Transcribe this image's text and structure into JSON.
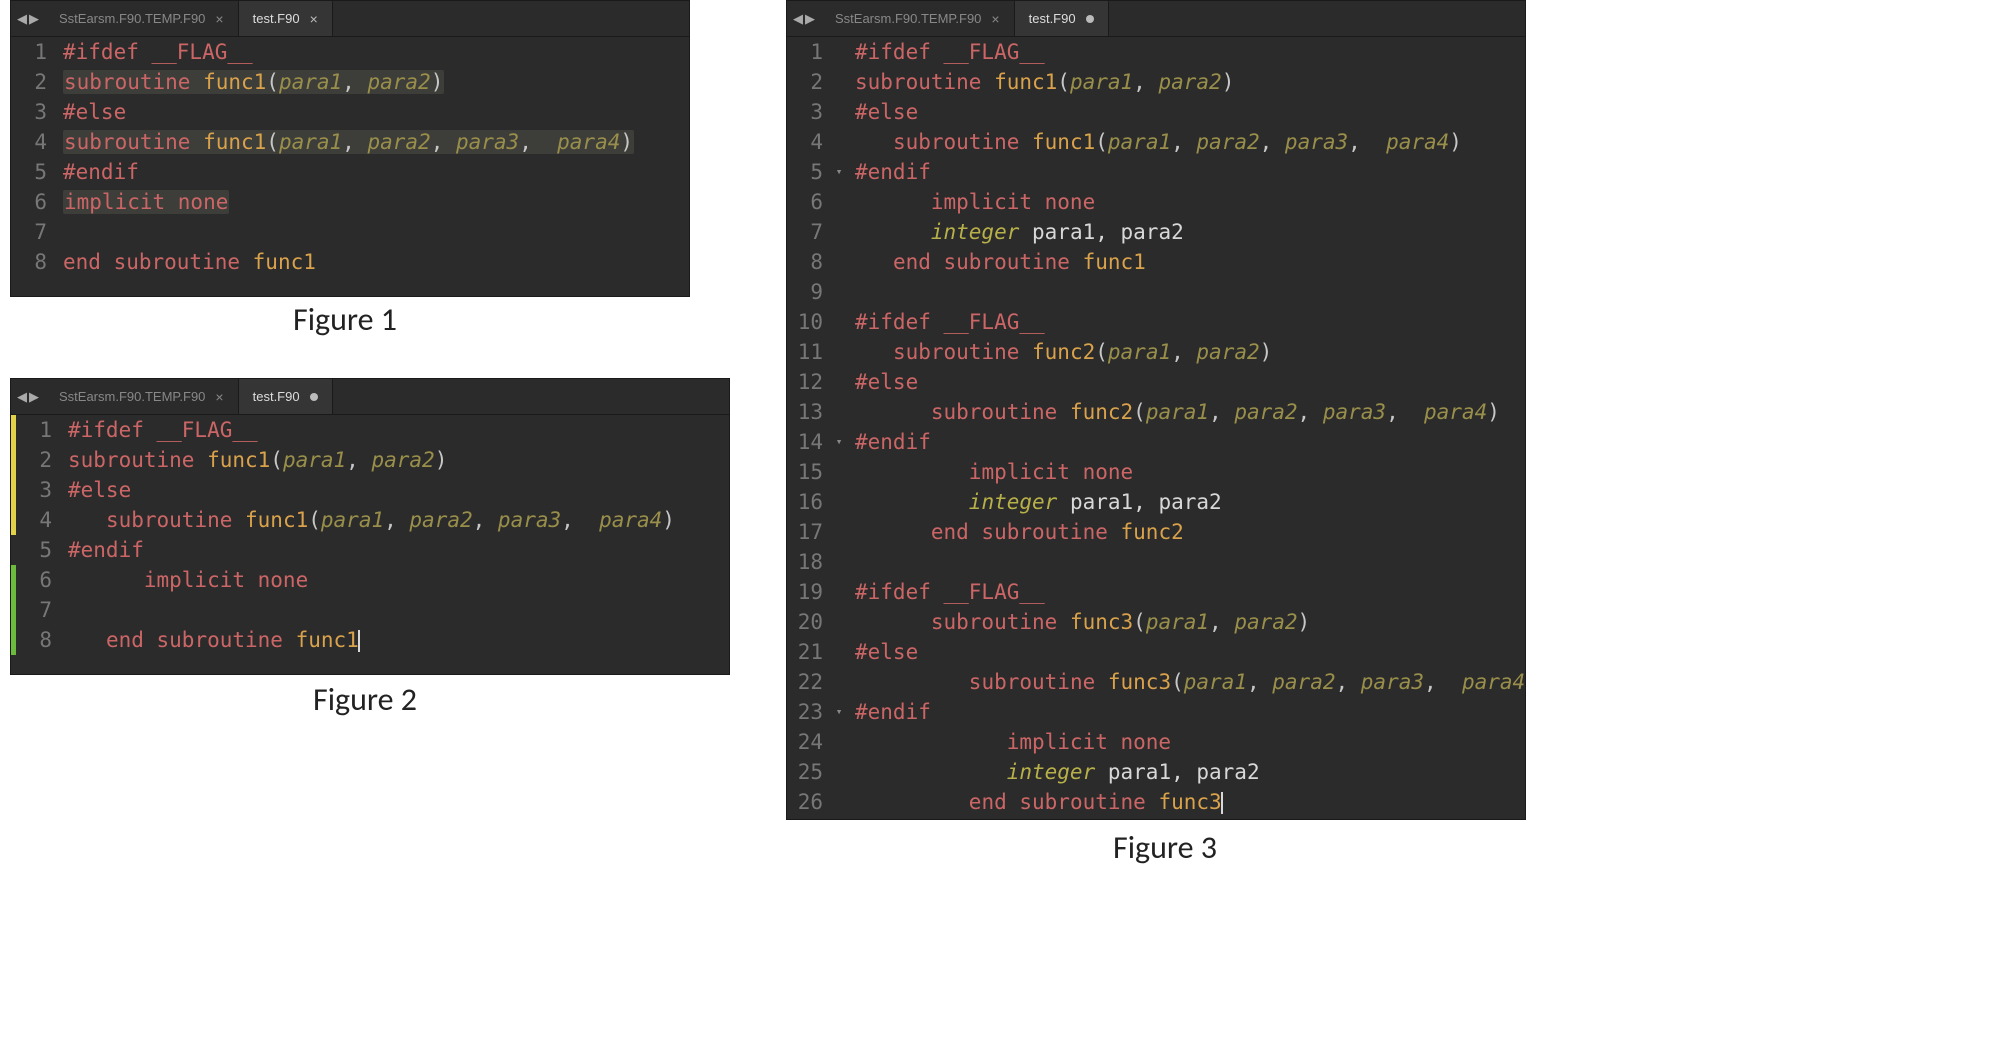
{
  "captions": {
    "fig1": "Figure 1",
    "fig2": "Figure 2",
    "fig3": "Figure 3"
  },
  "tabs": {
    "inactive_label": "SstEarsm.F90.TEMP.F90",
    "active_label": "test.F90"
  },
  "fig1": {
    "lines": [
      {
        "n": "1",
        "segs": [
          [
            "pp",
            "#ifdef __FLAG__"
          ]
        ]
      },
      {
        "n": "2",
        "segs": [
          [
            "kw",
            "subroutine "
          ],
          [
            "fn",
            "func1"
          ],
          [
            "paren",
            "("
          ],
          [
            "par",
            "para1"
          ],
          [
            "paren",
            ", "
          ],
          [
            "par",
            "para2"
          ],
          [
            "paren",
            ")"
          ]
        ],
        "hl": true
      },
      {
        "n": "3",
        "segs": [
          [
            "pp",
            "#else"
          ]
        ]
      },
      {
        "n": "4",
        "segs": [
          [
            "kw",
            "subroutine "
          ],
          [
            "fn",
            "func1"
          ],
          [
            "paren",
            "("
          ],
          [
            "par",
            "para1"
          ],
          [
            "paren",
            ", "
          ],
          [
            "par",
            "para2"
          ],
          [
            "paren",
            ", "
          ],
          [
            "par",
            "para3"
          ],
          [
            "paren",
            ",  "
          ],
          [
            "par",
            "para4"
          ],
          [
            "paren",
            ")"
          ]
        ],
        "hl": true
      },
      {
        "n": "5",
        "segs": [
          [
            "pp",
            "#endif"
          ]
        ]
      },
      {
        "n": "6",
        "segs": [
          [
            "kw",
            "implicit none"
          ]
        ],
        "hl": true
      },
      {
        "n": "7",
        "segs": []
      },
      {
        "n": "8",
        "segs": [
          [
            "kw",
            "end subroutine "
          ],
          [
            "fn",
            "func1"
          ]
        ]
      }
    ]
  },
  "fig2": {
    "markers": [
      "yellow",
      "yellow",
      "yellow",
      "yellow",
      "",
      "green",
      "green",
      "green"
    ],
    "lines": [
      {
        "n": "1",
        "segs": [
          [
            "pp",
            "#ifdef __FLAG__"
          ]
        ]
      },
      {
        "n": "2",
        "segs": [
          [
            "kw",
            "subroutine "
          ],
          [
            "fn",
            "func1"
          ],
          [
            "paren",
            "("
          ],
          [
            "par",
            "para1"
          ],
          [
            "paren",
            ", "
          ],
          [
            "par",
            "para2"
          ],
          [
            "paren",
            ")"
          ]
        ]
      },
      {
        "n": "3",
        "segs": [
          [
            "pp",
            "#else"
          ]
        ]
      },
      {
        "n": "4",
        "segs": [
          [
            "id",
            "   "
          ],
          [
            "kw",
            "subroutine "
          ],
          [
            "fn",
            "func1"
          ],
          [
            "paren",
            "("
          ],
          [
            "par",
            "para1"
          ],
          [
            "paren",
            ", "
          ],
          [
            "par",
            "para2"
          ],
          [
            "paren",
            ", "
          ],
          [
            "par",
            "para3"
          ],
          [
            "paren",
            ",  "
          ],
          [
            "par",
            "para4"
          ],
          [
            "paren",
            ")"
          ]
        ]
      },
      {
        "n": "5",
        "segs": [
          [
            "pp",
            "#endif"
          ]
        ]
      },
      {
        "n": "6",
        "segs": [
          [
            "id",
            "      "
          ],
          [
            "kw",
            "implicit none"
          ]
        ]
      },
      {
        "n": "7",
        "segs": []
      },
      {
        "n": "8",
        "segs": [
          [
            "id",
            "   "
          ],
          [
            "kw",
            "end subroutine "
          ],
          [
            "fn",
            "func1"
          ]
        ],
        "cursor": true
      }
    ]
  },
  "fig3": {
    "fold_at": [
      5,
      14,
      23
    ],
    "lines": [
      {
        "n": "1",
        "segs": [
          [
            "pp",
            "#ifdef __FLAG__"
          ]
        ]
      },
      {
        "n": "2",
        "segs": [
          [
            "kw",
            "subroutine "
          ],
          [
            "fn",
            "func1"
          ],
          [
            "paren",
            "("
          ],
          [
            "par",
            "para1"
          ],
          [
            "paren",
            ", "
          ],
          [
            "par",
            "para2"
          ],
          [
            "paren",
            ")"
          ]
        ]
      },
      {
        "n": "3",
        "segs": [
          [
            "pp",
            "#else"
          ]
        ]
      },
      {
        "n": "4",
        "segs": [
          [
            "id",
            "   "
          ],
          [
            "kw",
            "subroutine "
          ],
          [
            "fn",
            "func1"
          ],
          [
            "paren",
            "("
          ],
          [
            "par",
            "para1"
          ],
          [
            "paren",
            ", "
          ],
          [
            "par",
            "para2"
          ],
          [
            "paren",
            ", "
          ],
          [
            "par",
            "para3"
          ],
          [
            "paren",
            ",  "
          ],
          [
            "par",
            "para4"
          ],
          [
            "paren",
            ")"
          ]
        ]
      },
      {
        "n": "5",
        "segs": [
          [
            "pp",
            "#endif"
          ]
        ]
      },
      {
        "n": "6",
        "segs": [
          [
            "id",
            "      "
          ],
          [
            "kw",
            "implicit none"
          ]
        ]
      },
      {
        "n": "7",
        "segs": [
          [
            "id",
            "      "
          ],
          [
            "type",
            "integer"
          ],
          [
            "id",
            " para1, para2"
          ]
        ]
      },
      {
        "n": "8",
        "segs": [
          [
            "id",
            "   "
          ],
          [
            "kw",
            "end subroutine "
          ],
          [
            "fn",
            "func1"
          ]
        ]
      },
      {
        "n": "9",
        "segs": []
      },
      {
        "n": "10",
        "segs": [
          [
            "pp",
            "#ifdef __FLAG__"
          ]
        ]
      },
      {
        "n": "11",
        "segs": [
          [
            "id",
            "   "
          ],
          [
            "kw",
            "subroutine "
          ],
          [
            "fn",
            "func2"
          ],
          [
            "paren",
            "("
          ],
          [
            "par",
            "para1"
          ],
          [
            "paren",
            ", "
          ],
          [
            "par",
            "para2"
          ],
          [
            "paren",
            ")"
          ]
        ]
      },
      {
        "n": "12",
        "segs": [
          [
            "pp",
            "#else"
          ]
        ]
      },
      {
        "n": "13",
        "segs": [
          [
            "id",
            "      "
          ],
          [
            "kw",
            "subroutine "
          ],
          [
            "fn",
            "func2"
          ],
          [
            "paren",
            "("
          ],
          [
            "par",
            "para1"
          ],
          [
            "paren",
            ", "
          ],
          [
            "par",
            "para2"
          ],
          [
            "paren",
            ", "
          ],
          [
            "par",
            "para3"
          ],
          [
            "paren",
            ",  "
          ],
          [
            "par",
            "para4"
          ],
          [
            "paren",
            ")"
          ]
        ]
      },
      {
        "n": "14",
        "segs": [
          [
            "pp",
            "#endif"
          ]
        ]
      },
      {
        "n": "15",
        "segs": [
          [
            "id",
            "         "
          ],
          [
            "kw",
            "implicit none"
          ]
        ]
      },
      {
        "n": "16",
        "segs": [
          [
            "id",
            "         "
          ],
          [
            "type",
            "integer"
          ],
          [
            "id",
            " para1, para2"
          ]
        ]
      },
      {
        "n": "17",
        "segs": [
          [
            "id",
            "      "
          ],
          [
            "kw",
            "end subroutine "
          ],
          [
            "fn",
            "func2"
          ]
        ]
      },
      {
        "n": "18",
        "segs": []
      },
      {
        "n": "19",
        "segs": [
          [
            "pp",
            "#ifdef __FLAG__"
          ]
        ]
      },
      {
        "n": "20",
        "segs": [
          [
            "id",
            "      "
          ],
          [
            "kw",
            "subroutine "
          ],
          [
            "fn",
            "func3"
          ],
          [
            "paren",
            "("
          ],
          [
            "par",
            "para1"
          ],
          [
            "paren",
            ", "
          ],
          [
            "par",
            "para2"
          ],
          [
            "paren",
            ")"
          ]
        ]
      },
      {
        "n": "21",
        "segs": [
          [
            "pp",
            "#else"
          ]
        ]
      },
      {
        "n": "22",
        "segs": [
          [
            "id",
            "         "
          ],
          [
            "kw",
            "subroutine "
          ],
          [
            "fn",
            "func3"
          ],
          [
            "paren",
            "("
          ],
          [
            "par",
            "para1"
          ],
          [
            "paren",
            ", "
          ],
          [
            "par",
            "para2"
          ],
          [
            "paren",
            ", "
          ],
          [
            "par",
            "para3"
          ],
          [
            "paren",
            ",  "
          ],
          [
            "par",
            "para4"
          ],
          [
            "paren",
            ")"
          ]
        ]
      },
      {
        "n": "23",
        "segs": [
          [
            "pp",
            "#endif"
          ]
        ]
      },
      {
        "n": "24",
        "segs": [
          [
            "id",
            "            "
          ],
          [
            "kw",
            "implicit none"
          ]
        ]
      },
      {
        "n": "25",
        "segs": [
          [
            "id",
            "            "
          ],
          [
            "type",
            "integer"
          ],
          [
            "id",
            " para1, para2"
          ]
        ]
      },
      {
        "n": "26",
        "segs": [
          [
            "id",
            "         "
          ],
          [
            "kw",
            "end subroutine "
          ],
          [
            "fn",
            "func3"
          ]
        ],
        "cursor": true
      }
    ]
  }
}
